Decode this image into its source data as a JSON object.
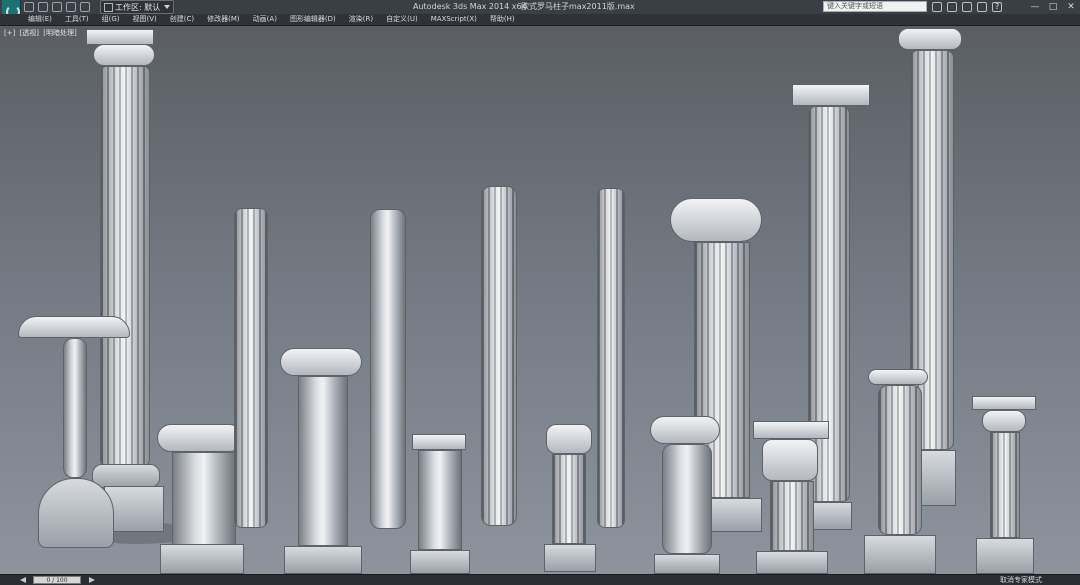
{
  "titlebar": {
    "workspace_label": "工作区: 默认",
    "app_title": "Autodesk 3ds Max  2014 x64",
    "file_title": "欧式罗马柱子max2011版.max",
    "search_placeholder": "键入关键字或短语"
  },
  "menus": [
    {
      "label": "编辑(E)"
    },
    {
      "label": "工具(T)"
    },
    {
      "label": "组(G)"
    },
    {
      "label": "视图(V)"
    },
    {
      "label": "创建(C)"
    },
    {
      "label": "修改器(M)"
    },
    {
      "label": "动画(A)"
    },
    {
      "label": "图形编辑器(D)"
    },
    {
      "label": "渲染(R)"
    },
    {
      "label": "自定义(U)"
    },
    {
      "label": "MAXScript(X)"
    },
    {
      "label": "帮助(H)"
    }
  ],
  "viewport": {
    "label_parts": [
      "[+]",
      "[透视]",
      "[明暗处理]"
    ]
  },
  "timebar": {
    "frame_counter": "0 / 100",
    "status_text": "取消专家模式"
  },
  "colors": {
    "titlebar_bg": "#3a3f45",
    "menubar_bg": "#2f3338",
    "viewport_top": "#5a5e64",
    "viewport_bottom": "#8e949d",
    "ui_text": "#d9dde1"
  },
  "icons": {
    "app_logo": "3ds-max-logo-icon",
    "new_file": "new-file-icon",
    "open_file": "open-file-icon",
    "save_file": "save-file-icon",
    "undo": "undo-icon",
    "redo": "redo-icon",
    "workspace": "workspace-icon",
    "search": "search-icon",
    "help": "help-icon",
    "minimize": "minimize-icon",
    "maximize": "maximize-icon",
    "close": "close-icon"
  }
}
